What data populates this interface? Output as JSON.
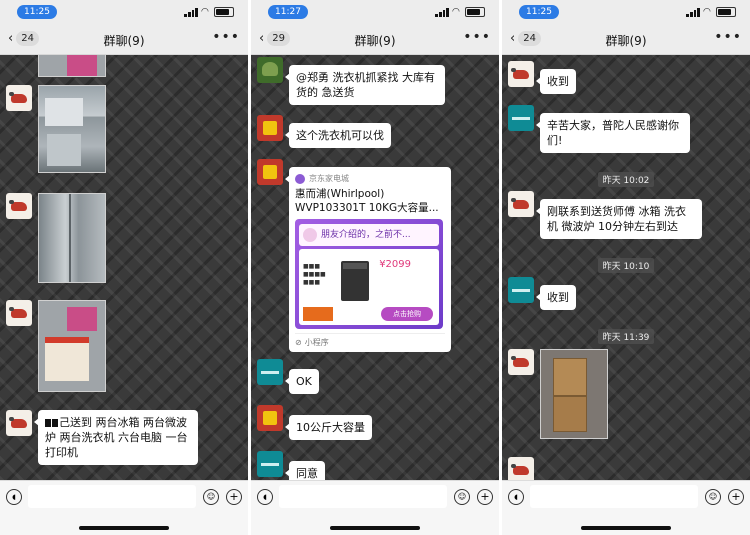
{
  "phones": [
    {
      "time": "11:25",
      "back_count": "24",
      "title": "群聊(9)",
      "more": "•••"
    },
    {
      "time": "11:27",
      "back_count": "29",
      "title": "群聊(9)",
      "more": "•••"
    },
    {
      "time": "11:25",
      "back_count": "24",
      "title": "群聊(9)",
      "more": "•••"
    }
  ],
  "phone1": {
    "msg_text": "己送到 两台冰箱 两台微波炉 两台洗衣机 六台电脑 一台打印机"
  },
  "phone2": {
    "msg1": "@郑勇 洗衣机抓紧找 大库有货的 急送货",
    "msg2": "这个洗衣机可以伐",
    "mp_source": "京东家电城",
    "mp_title": "惠而浦(Whirlpool) WVP103301T 10KG大容量...",
    "mp_banner": "朋友介绍的，之前不...",
    "mp_price": "¥2099",
    "mp_btn": "点击抢购",
    "mp_footer": "小程序",
    "msg3": "OK",
    "msg4": "10公斤大容量",
    "msg5": "同意"
  },
  "phone3": {
    "msg1": "收到",
    "msg2": "辛苦大家，普陀人民感谢你们!",
    "time1": "昨天 10:02",
    "msg3": "刚联系到送货师傅 冰箱 洗衣机 微波炉 10分钟左右到达",
    "time2": "昨天 10:10",
    "msg4": "收到",
    "time3": "昨天 11:39"
  },
  "icons": {
    "voice": "voice-icon",
    "emoji": "emoji-icon",
    "plus": "plus-icon"
  }
}
